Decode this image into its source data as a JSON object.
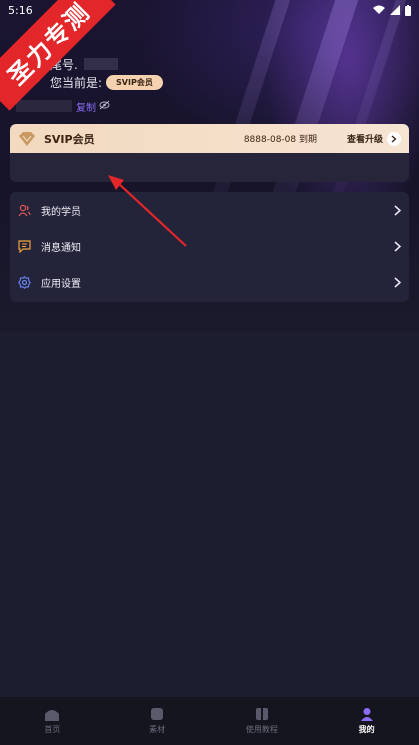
{
  "status_bar": {
    "time": "5:16"
  },
  "watermark": {
    "text": "圣力专测"
  },
  "profile": {
    "tail_label": "尾号.",
    "level_label": "您当前是:",
    "level_badge": "SVIP会员",
    "copy_label": "复制"
  },
  "vip_card": {
    "title": "SVIP会员",
    "expire": "8888-08-08 到期",
    "upgrade": "查看升级"
  },
  "menu": {
    "items": [
      {
        "label": "我的学员",
        "icon": "users-icon"
      },
      {
        "label": "消息通知",
        "icon": "message-icon"
      },
      {
        "label": "应用设置",
        "icon": "gear-icon"
      }
    ]
  },
  "tabbar": {
    "tabs": [
      {
        "label": "首页",
        "icon": "home-icon"
      },
      {
        "label": "素材",
        "icon": "material-icon"
      },
      {
        "label": "使用教程",
        "icon": "tutorial-icon"
      },
      {
        "label": "我的",
        "icon": "profile-icon",
        "active": true
      }
    ]
  },
  "colors": {
    "accent": "#8a6df2",
    "vip_gold": "#f2d9bf",
    "watermark_red": "#e3262a",
    "arrow_red": "#e3262a"
  }
}
